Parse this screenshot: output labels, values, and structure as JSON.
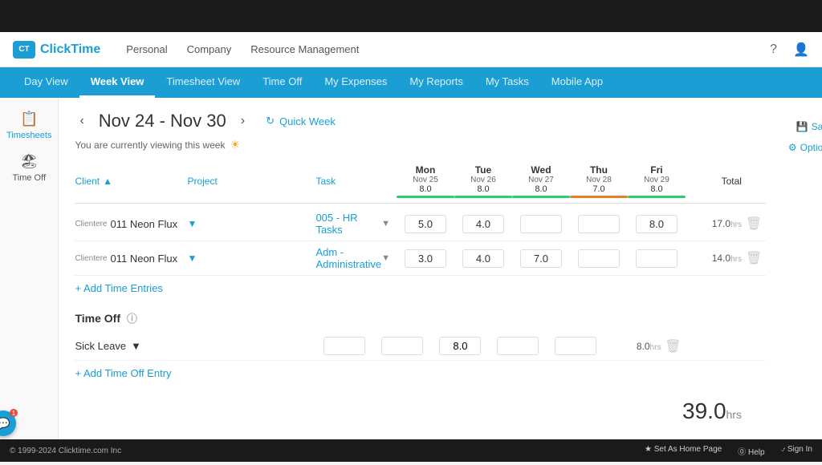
{
  "topBar": {},
  "header": {
    "logo": "ClickTime",
    "nav": [
      "Personal",
      "Company",
      "Resource Management"
    ]
  },
  "tabs": {
    "items": [
      "Day View",
      "Week View",
      "Timesheet View",
      "Time Off",
      "My Expenses",
      "My Reports",
      "My Tasks",
      "Mobile App"
    ],
    "active": "Week View"
  },
  "sidebar": {
    "items": [
      {
        "label": "Timesheets",
        "icon": "📋"
      },
      {
        "label": "Time Off",
        "icon": "🏖"
      }
    ],
    "active": "Timesheets"
  },
  "weekHeader": {
    "title": "Nov 24 - Nov 30",
    "quickWeekLabel": "Quick Week",
    "viewingNotice": "You are currently viewing this week"
  },
  "actions": {
    "save": "Save",
    "options": "Options"
  },
  "tableHeaders": {
    "client": "Client",
    "project": "Project",
    "task": "Task",
    "total": "Total"
  },
  "days": [
    {
      "name": "Mon",
      "date": "Nov 25",
      "hours": "8.0",
      "barColor": "green"
    },
    {
      "name": "Tue",
      "date": "Nov 26",
      "hours": "8.0",
      "barColor": "green"
    },
    {
      "name": "Wed",
      "date": "Nov 27",
      "hours": "8.0",
      "barColor": "green"
    },
    {
      "name": "Thu",
      "date": "Nov 28",
      "hours": "7.0",
      "barColor": "orange"
    },
    {
      "name": "Fri",
      "date": "Nov 29",
      "hours": "8.0",
      "barColor": "green"
    }
  ],
  "entries": [
    {
      "clientLabel": "Clientere",
      "client": "011 Neon Flux",
      "task": "005 - HR Tasks",
      "monHours": "5.0",
      "tueHours": "4.0",
      "wedHours": "",
      "thuHours": "",
      "friHours": "8.0",
      "total": "17.0",
      "totalUnit": "hrs"
    },
    {
      "clientLabel": "Clientere",
      "client": "011 Neon Flux",
      "task": "Adm - Administrative",
      "monHours": "3.0",
      "tueHours": "4.0",
      "wedHours": "7.0",
      "thuHours": "",
      "friHours": "",
      "total": "14.0",
      "totalUnit": "hrs"
    }
  ],
  "addTimeEntries": "+ Add Time Entries",
  "timeOffSection": {
    "label": "Time Off"
  },
  "timeOffEntries": [
    {
      "type": "Sick Leave",
      "monHours": "",
      "tueHours": "",
      "wedHours": "8.0",
      "thuHours": "",
      "friHours": "",
      "total": "8.0",
      "totalUnit": "hrs"
    }
  ],
  "addTimeOffEntry": "+ Add Time Off Entry",
  "grandTotal": {
    "value": "39.0",
    "unit": "hrs"
  },
  "footer": {
    "copyright": "© 1999-2024 Clicktime.com Inc",
    "setHome": "★ Set As Home Page",
    "help": "⓪ Help",
    "signIn": "⍻ Sign In"
  }
}
